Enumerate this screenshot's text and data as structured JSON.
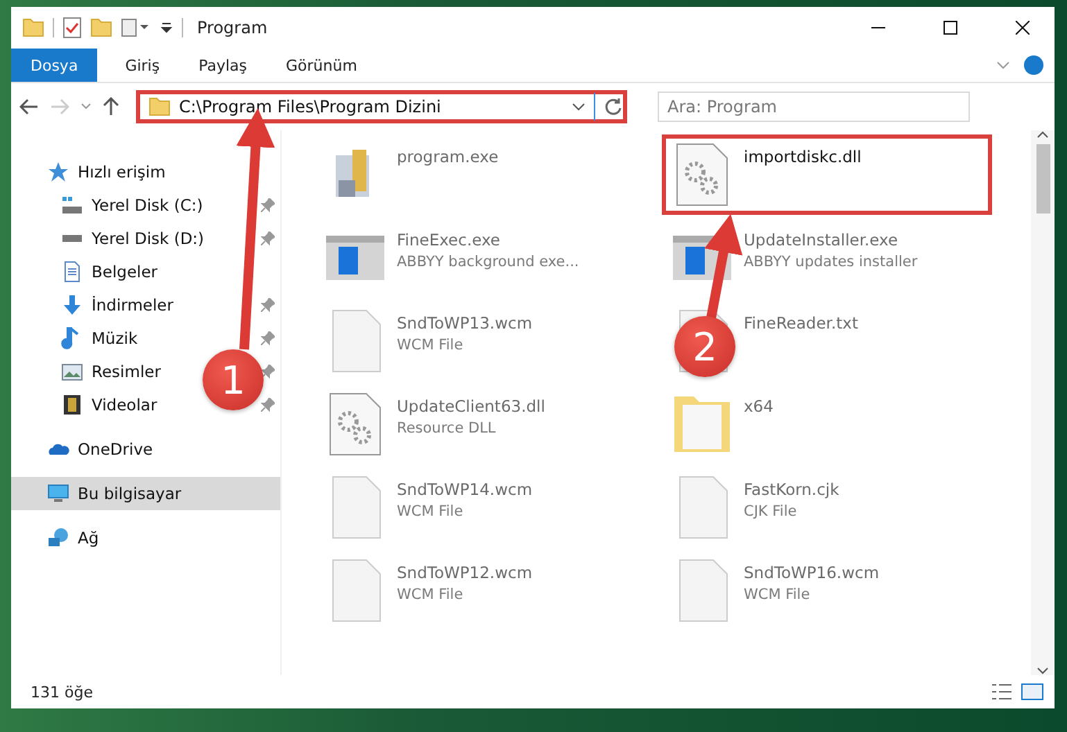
{
  "window": {
    "title": "Program"
  },
  "ribbon_tabs": [
    {
      "label": "Dosya",
      "kind": "file"
    },
    {
      "label": "Giriş",
      "kind": "tab"
    },
    {
      "label": "Paylaş",
      "kind": "tab"
    },
    {
      "label": "Görünüm",
      "kind": "tab"
    }
  ],
  "address_bar": {
    "path": "C:\\Program Files\\Program Dizini",
    "highlighted": true
  },
  "search": {
    "placeholder": "Ara: Program"
  },
  "sidebar": {
    "items": [
      {
        "label": "Hızlı erişim",
        "kind": "header",
        "pinned": false,
        "selected": false
      },
      {
        "label": "Yerel Disk (C:)",
        "kind": "item",
        "pinned": true,
        "selected": false
      },
      {
        "label": "Yerel Disk (D:)",
        "kind": "item",
        "pinned": true,
        "selected": false
      },
      {
        "label": "Belgeler",
        "kind": "item",
        "pinned": false,
        "selected": false
      },
      {
        "label": "İndirmeler",
        "kind": "item",
        "pinned": true,
        "selected": false
      },
      {
        "label": "Müzik",
        "kind": "item",
        "pinned": true,
        "selected": false
      },
      {
        "label": "Resimler",
        "kind": "item",
        "pinned": true,
        "selected": false
      },
      {
        "label": "Videolar",
        "kind": "item",
        "pinned": true,
        "selected": false
      },
      {
        "label": "OneDrive",
        "kind": "header",
        "pinned": false,
        "selected": false
      },
      {
        "label": "Bu bilgisayar",
        "kind": "header",
        "pinned": false,
        "selected": true
      },
      {
        "label": "Ağ",
        "kind": "header",
        "pinned": false,
        "selected": false
      }
    ]
  },
  "files": [
    {
      "name": "program.exe",
      "kind": "setup",
      "faded": true,
      "highlighted": false
    },
    {
      "name": "importdiskc.dll",
      "kind": "dll",
      "faded": false,
      "highlighted": true
    },
    {
      "name": "FineExec.exe",
      "type": "ABBYY background exe...",
      "kind": "app",
      "faded": true,
      "highlighted": false
    },
    {
      "name": "UpdateInstaller.exe",
      "type": "ABBYY updates installer",
      "kind": "app",
      "faded": true,
      "highlighted": false
    },
    {
      "name": "SndToWP13.wcm",
      "type": "WCM File",
      "kind": "file",
      "faded": true,
      "highlighted": false
    },
    {
      "name": "FineReader.txt",
      "kind": "file",
      "faded": true,
      "highlighted": false
    },
    {
      "name": "UpdateClient63.dll",
      "type": "Resource DLL",
      "kind": "dll",
      "faded": true,
      "highlighted": false
    },
    {
      "name": "x64",
      "kind": "folder",
      "faded": true,
      "highlighted": false
    },
    {
      "name": "SndToWP14.wcm",
      "type": "WCM File",
      "kind": "file",
      "faded": true,
      "highlighted": false
    },
    {
      "name": "FastKorn.cjk",
      "type": "CJK File",
      "kind": "file",
      "faded": true,
      "highlighted": false
    },
    {
      "name": "SndToWP12.wcm",
      "type": "WCM File",
      "kind": "file",
      "faded": true,
      "highlighted": false
    },
    {
      "name": "SndToWP16.wcm",
      "type": "WCM File",
      "kind": "file",
      "faded": true,
      "highlighted": false
    }
  ],
  "status_bar": {
    "count": "131 öğe"
  },
  "annotations": [
    {
      "number": "1"
    },
    {
      "number": "2"
    }
  ]
}
